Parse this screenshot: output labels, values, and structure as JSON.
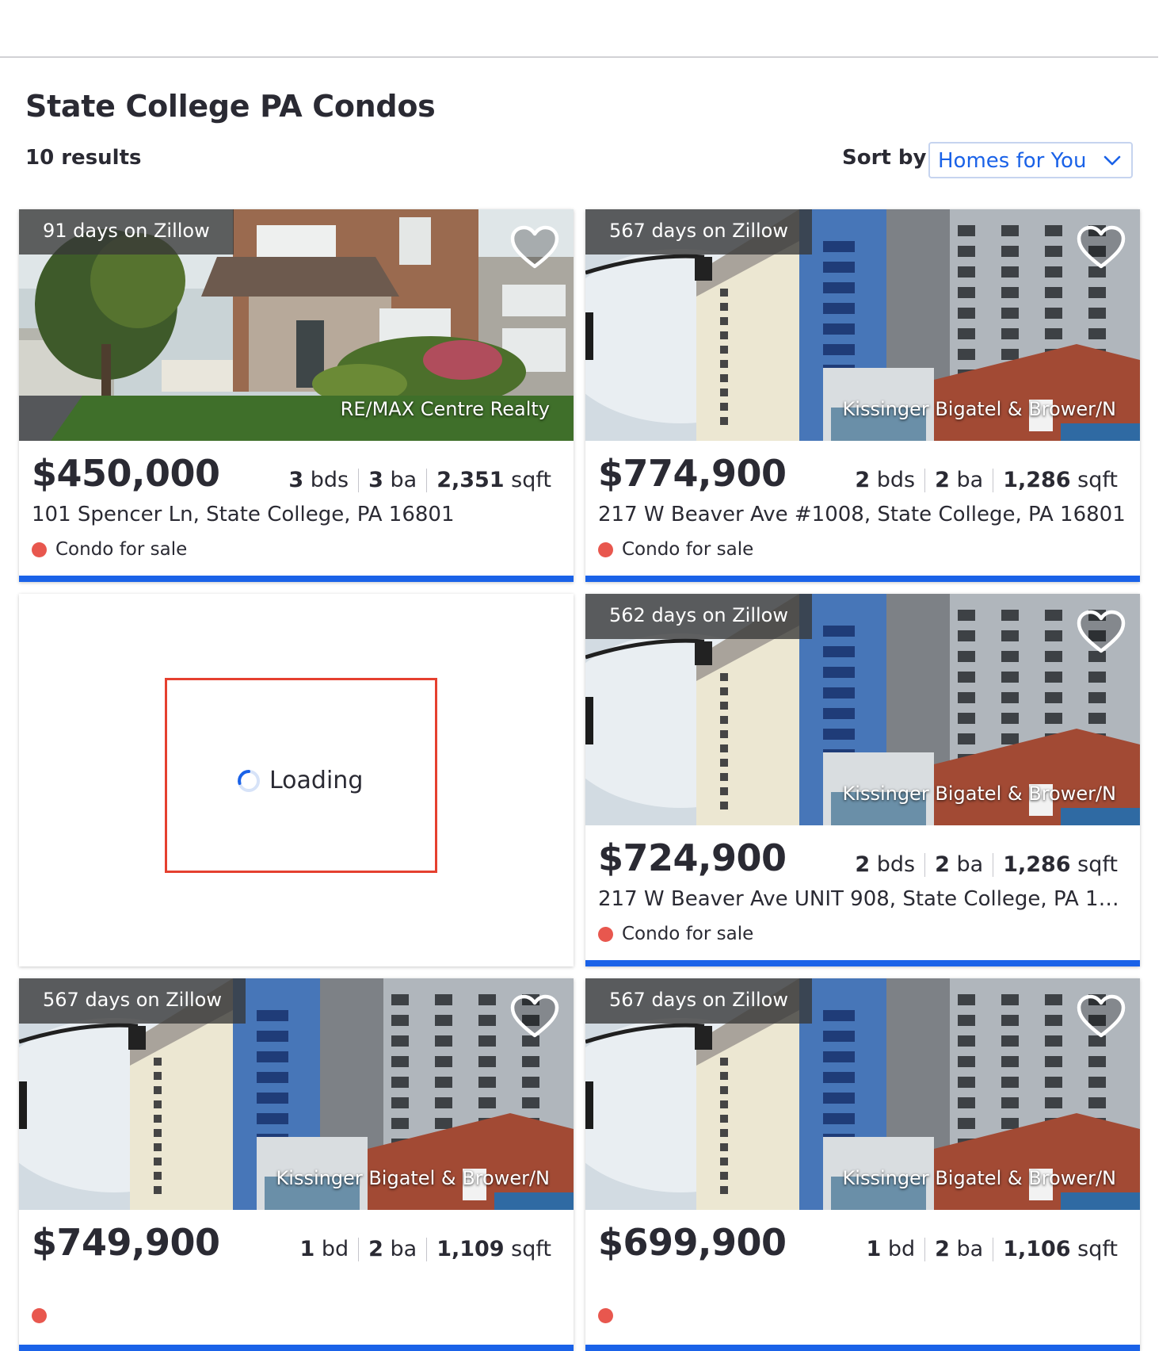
{
  "page": {
    "title": "State College PA Condos",
    "result_count": "10 results",
    "sort_label": "Sort by:",
    "sort_value": "Homes for You"
  },
  "loading_text": "Loading",
  "listings": [
    {
      "days": "91 days on Zillow",
      "brokerage": "RE/MAX Centre Realty",
      "price": "$450,000",
      "beds": "3",
      "beds_unit": " bds",
      "baths": "3",
      "baths_unit": " ba",
      "sqft": "2,351",
      "sqft_unit": " sqft",
      "address": "101 Spencer Ln, State College, PA 16801",
      "status": "Condo for sale",
      "photo": "house"
    },
    {
      "days": "567 days on Zillow",
      "brokerage": "Kissinger Bigatel & Brower/N",
      "price": "$774,900",
      "beds": "2",
      "beds_unit": " bds",
      "baths": "2",
      "baths_unit": " ba",
      "sqft": "1,286",
      "sqft_unit": " sqft",
      "address": "217 W Beaver Ave #1008, State College, PA 16801",
      "status": "Condo for sale",
      "photo": "building"
    },
    {
      "days": "562 days on Zillow",
      "brokerage": "Kissinger Bigatel & Brower/N",
      "price": "$724,900",
      "beds": "2",
      "beds_unit": " bds",
      "baths": "2",
      "baths_unit": " ba",
      "sqft": "1,286",
      "sqft_unit": " sqft",
      "address": "217 W Beaver Ave UNIT 908, State College, PA 16...",
      "status": "Condo for sale",
      "photo": "building"
    },
    {
      "days": "567 days on Zillow",
      "brokerage": "Kissinger Bigatel & Brower/N",
      "price": "$749,900",
      "beds": "1",
      "beds_unit": " bd",
      "baths": "2",
      "baths_unit": " ba",
      "sqft": "1,109",
      "sqft_unit": " sqft",
      "address": "",
      "status": "",
      "photo": "building"
    },
    {
      "days": "567 days on Zillow",
      "brokerage": "Kissinger Bigatel & Brower/N",
      "price": "$699,900",
      "beds": "1",
      "beds_unit": " bd",
      "baths": "2",
      "baths_unit": " ba",
      "sqft": "1,106",
      "sqft_unit": " sqft",
      "address": "",
      "status": "",
      "photo": "building"
    }
  ]
}
